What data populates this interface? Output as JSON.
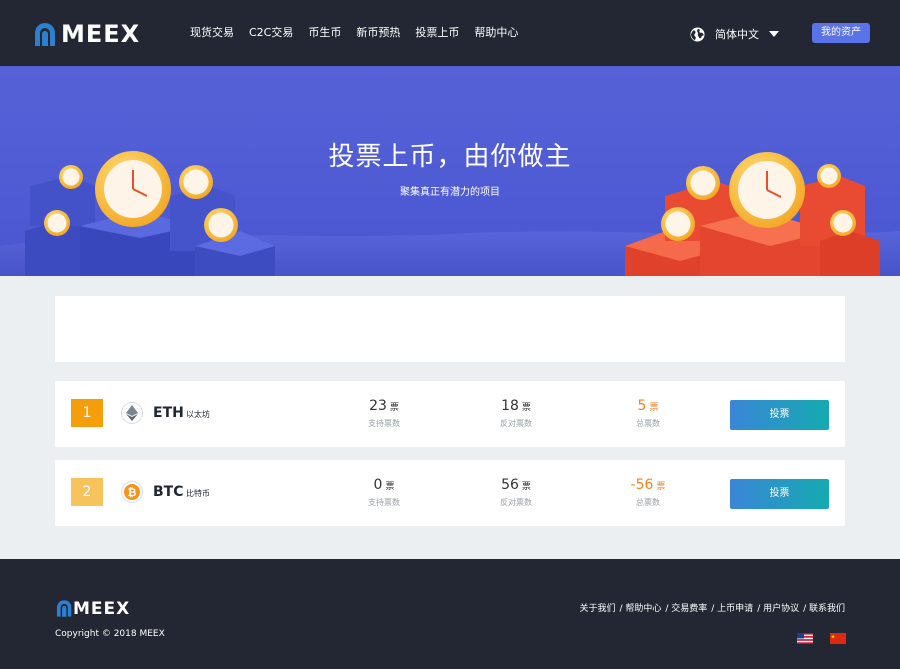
{
  "header": {
    "logo_text": "MEEX",
    "nav": [
      "现货交易",
      "C2C交易",
      "币生币",
      "新币预热",
      "投票上币",
      "帮助中心"
    ],
    "language": "简体中文",
    "assets_button": "我的资产"
  },
  "banner": {
    "title": "投票上币，由你做主",
    "subtitle": "聚集真正有潜力的项目"
  },
  "coins": [
    {
      "rank": "1",
      "symbol": "ETH",
      "name_cn": "以太坊",
      "icon": "ethereum-icon",
      "support": "23",
      "against": "18",
      "total": "5",
      "rank_color": "#f59e0b"
    },
    {
      "rank": "2",
      "symbol": "BTC",
      "name_cn": "比特币",
      "icon": "bitcoin-icon",
      "support": "0",
      "against": "56",
      "total": "-56",
      "rank_color": "#f7c35c"
    }
  ],
  "labels": {
    "unit": "票",
    "support": "支持票数",
    "against": "反对票数",
    "total": "总票数",
    "vote_button": "投票"
  },
  "footer": {
    "logo_text": "MEEX",
    "copyright": "Copyright © 2018 MEEX",
    "links": [
      "关于我们",
      "/ 帮助中心",
      "/ 交易费率",
      "/ 上币申请",
      "/ 用户协议",
      "/ 联系我们"
    ],
    "flags": [
      "us-flag-icon",
      "cn-flag-icon"
    ]
  },
  "colors": {
    "header_bg": "#222733",
    "banner_bg": "#5160d6",
    "accent_orange": "#f5821f",
    "button_gradient": [
      "#3a86d8",
      "#15aab0"
    ]
  }
}
